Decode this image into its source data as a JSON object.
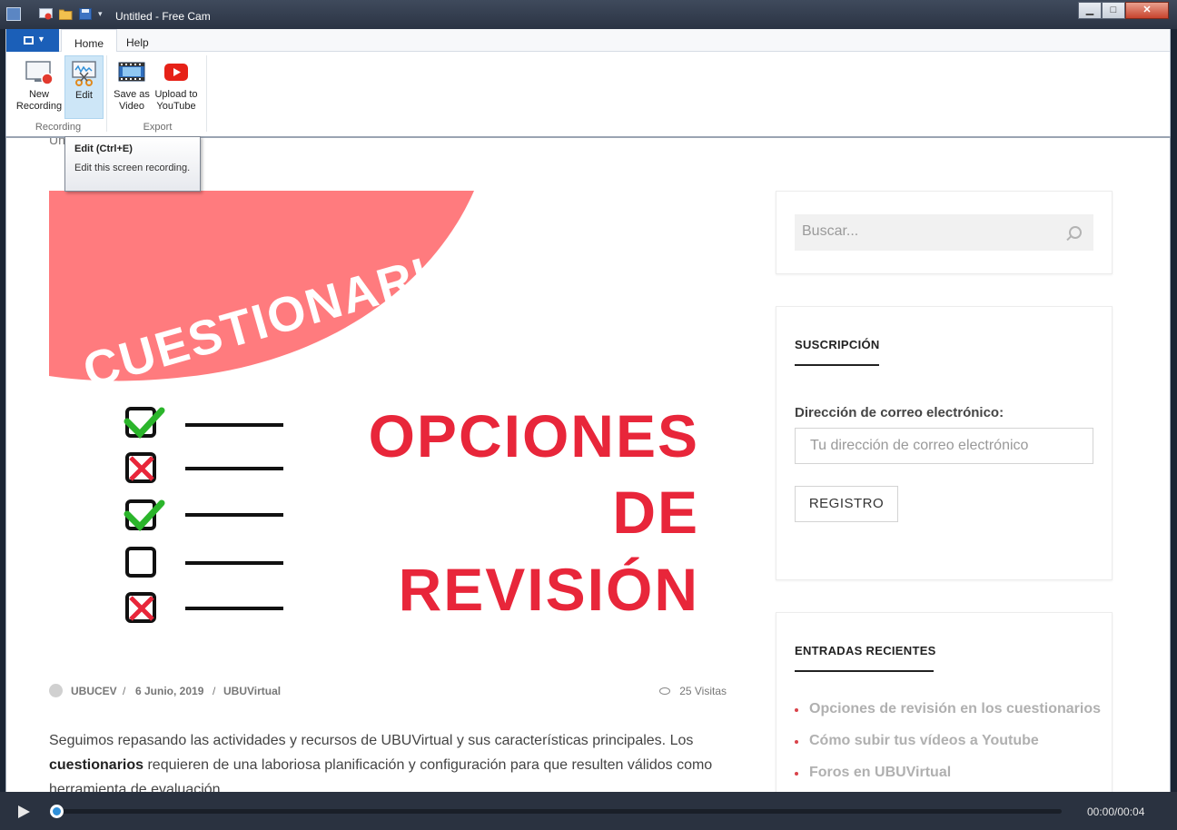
{
  "window": {
    "title": "Untitled - Free Cam",
    "controls": {
      "minimize": "▁",
      "maximize": "□",
      "close": "✕"
    }
  },
  "ribbon": {
    "tabs": [
      {
        "label": "Home",
        "active": true
      },
      {
        "label": "Help",
        "active": false
      }
    ],
    "buttons": {
      "new_recording": "New\nRecording",
      "edit": "Edit",
      "save_as_video": "Save as\nVideo",
      "upload_youtube": "Upload to\nYouTube"
    },
    "groups": {
      "recording": "Recording",
      "export": "Export"
    }
  },
  "tooltip": {
    "title": "Edit (Ctrl+E)",
    "description": "Edit this screen recording."
  },
  "page": {
    "cut_text": "Un",
    "hero": {
      "banner_text": "CUESTIONARIOS",
      "heading_lines": [
        "OPCIONES",
        "DE",
        "REVISIÓN"
      ],
      "checklist": [
        "check",
        "cross",
        "check",
        "empty",
        "cross"
      ],
      "colors": {
        "banner": "#ff7b7e",
        "heading": "#e8263a",
        "check": "#2bb52b",
        "cross": "#e8263a"
      }
    },
    "meta": {
      "author": "UBUCEV",
      "date": "6 Junio, 2019",
      "category": "UBUVirtual",
      "views": "25 Visitas",
      "separator": "/"
    },
    "body": {
      "p1_start": "Seguimos repasando las actividades y recursos de UBUVirtual y sus características principales. Los ",
      "p1_bold": "cuestionarios",
      "p1_end": " requieren de una laboriosa planificación y configuración para que resulten válidos como herramienta de evaluación."
    }
  },
  "sidebar": {
    "search": {
      "placeholder": "Buscar..."
    },
    "subscription": {
      "title": "SUSCRIPCIÓN",
      "email_label": "Dirección de correo electrónico:",
      "email_placeholder": "Tu dirección de correo electrónico",
      "button": "REGISTRO"
    },
    "recent": {
      "title": "ENTRADAS RECIENTES",
      "items": [
        "Opciones de revisión en los cuestionarios",
        "Cómo subir tus vídeos a Youtube",
        "Foros en UBUVirtual"
      ]
    }
  },
  "player": {
    "timecode": "00:00/00:04",
    "progress": 0
  }
}
